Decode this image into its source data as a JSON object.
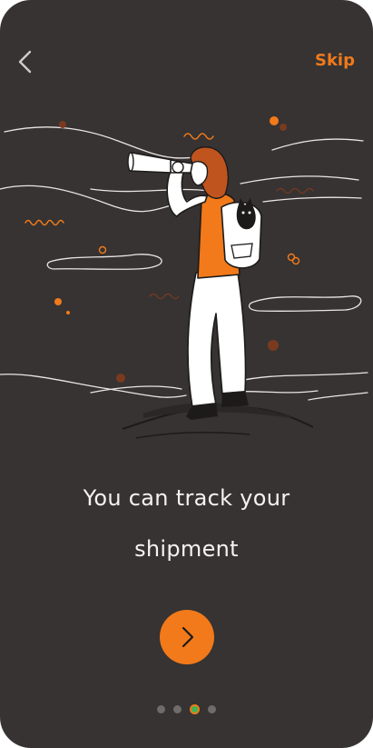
{
  "header": {
    "back_icon": "chevron-left-icon",
    "skip_label": "Skip"
  },
  "illustration": {
    "subject": "explorer-with-telescope-illustration"
  },
  "content": {
    "headline_line1": "You can track your",
    "headline_line2": "shipment"
  },
  "next_button": {
    "icon": "chevron-right-icon"
  },
  "pagination": {
    "total": 4,
    "active_index": 3
  },
  "colors": {
    "background": "#363332",
    "accent": "#f27a1a",
    "text": "#f5f3f2",
    "dot_inactive": "#6e6b6a",
    "dot_active": "#3cb553"
  }
}
